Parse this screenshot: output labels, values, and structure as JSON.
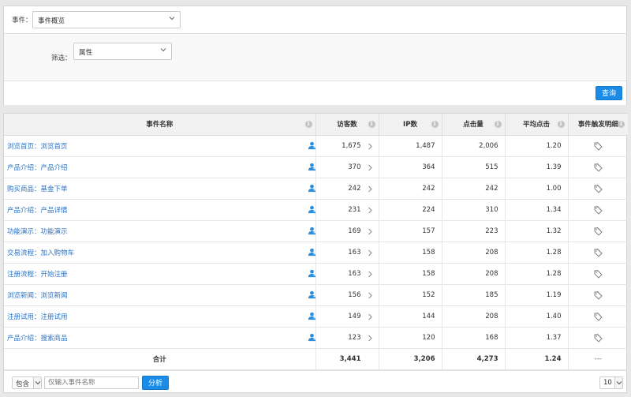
{
  "filter": {
    "event_label": "事件：",
    "event_value": "事件概览",
    "filter_label": "筛选：",
    "filter_value": "属性",
    "query_button": "查询"
  },
  "table": {
    "headers": [
      "事件名称",
      "访客数",
      "IP数",
      "点击量",
      "平均点击",
      "事件触发明细"
    ],
    "rows": [
      {
        "name": "浏览首页：浏览首页",
        "visitors": "1,675",
        "ip": "1,487",
        "clicks": "2,006",
        "avg": "1.20"
      },
      {
        "name": "产品介绍：产品介绍",
        "visitors": "370",
        "ip": "364",
        "clicks": "515",
        "avg": "1.39"
      },
      {
        "name": "购买商品：基金下单",
        "visitors": "242",
        "ip": "242",
        "clicks": "242",
        "avg": "1.00"
      },
      {
        "name": "产品介绍：产品详情",
        "visitors": "231",
        "ip": "224",
        "clicks": "310",
        "avg": "1.34"
      },
      {
        "name": "功能演示：功能演示",
        "visitors": "169",
        "ip": "157",
        "clicks": "223",
        "avg": "1.32"
      },
      {
        "name": "交易流程：加入购物车",
        "visitors": "163",
        "ip": "158",
        "clicks": "208",
        "avg": "1.28"
      },
      {
        "name": "注册流程：开始注册",
        "visitors": "163",
        "ip": "158",
        "clicks": "208",
        "avg": "1.28"
      },
      {
        "name": "浏览新闻：浏览新闻",
        "visitors": "156",
        "ip": "152",
        "clicks": "185",
        "avg": "1.19"
      },
      {
        "name": "注册试用：注册试用",
        "visitors": "149",
        "ip": "144",
        "clicks": "208",
        "avg": "1.40"
      },
      {
        "name": "产品介绍：搜索商品",
        "visitors": "123",
        "ip": "120",
        "clicks": "168",
        "avg": "1.37"
      }
    ],
    "total": {
      "label": "合计",
      "visitors": "3,441",
      "ip": "3,206",
      "clicks": "4,273",
      "avg": "1.24",
      "detail": "---"
    }
  },
  "footer": {
    "match_value": "包含",
    "search_placeholder": "仅输入事件名称",
    "analyze_button": "分析",
    "page_size": "10"
  },
  "colors": {
    "accent": "#1a8be6",
    "link": "#2a73c8"
  }
}
